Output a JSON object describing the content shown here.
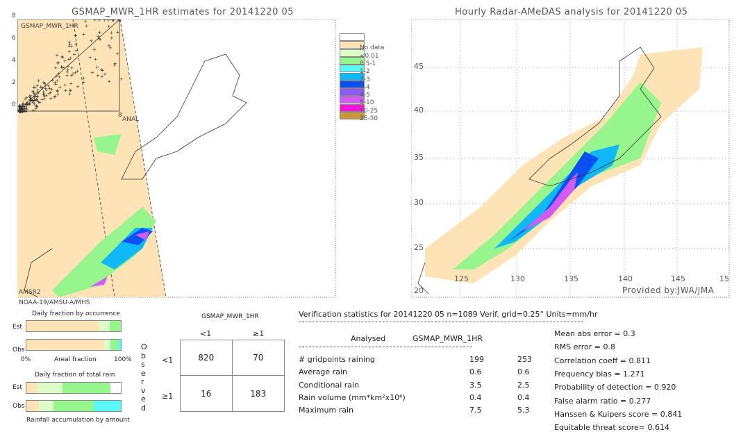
{
  "left_map": {
    "title": "GSMAP_MWR_1HR estimates for 20141220 05",
    "inset_label": "GSMAP_MWR_1HR",
    "inset_ticks": [
      "0",
      "2",
      "4",
      "6",
      "8"
    ],
    "inset_x_label": "ANAL",
    "sensor_label": "AMSR2",
    "satellite_label": "NOAA-19/AMSU-A/MHS"
  },
  "right_map": {
    "title": "Hourly Radar-AMeDAS analysis for 20141220 05",
    "lat_ticks": [
      "45",
      "40",
      "35",
      "30",
      "25",
      "20"
    ],
    "lon_ticks": [
      "125",
      "130",
      "135",
      "140",
      "145",
      "15"
    ],
    "credit": "Provided by:JWA/JMA"
  },
  "legend": [
    {
      "label": "",
      "color": "#ffffff"
    },
    {
      "label": "No data",
      "color": "#fde3b5"
    },
    {
      "label": "<0.01",
      "color": "#dcfcc8"
    },
    {
      "label": "0.5-1",
      "color": "#96f58c"
    },
    {
      "label": "1-2",
      "color": "#5cf8f8"
    },
    {
      "label": "2-3",
      "color": "#10b8f8"
    },
    {
      "label": "3-4",
      "color": "#0a50f5"
    },
    {
      "label": "4-5",
      "color": "#8c5af5"
    },
    {
      "label": "5-10",
      "color": "#d25af5"
    },
    {
      "label": "10-25",
      "color": "#f514dc"
    },
    {
      "label": "25-50",
      "color": "#c8963c"
    }
  ],
  "occurrence": {
    "title": "Daily fraction by occurrence",
    "est_label": "Est",
    "obs_label": "Obs",
    "axis_left": "0%",
    "axis_mid": "Areal fraction",
    "axis_right": "100%",
    "est": [
      {
        "pct": 77,
        "color": "#fde3b5"
      },
      {
        "pct": 11,
        "color": "#dcfcc8"
      },
      {
        "pct": 12,
        "color": "#96f58c"
      }
    ],
    "obs": [
      {
        "pct": 82,
        "color": "#fde3b5"
      },
      {
        "pct": 7,
        "color": "#dcfcc8"
      },
      {
        "pct": 8,
        "color": "#96f58c"
      },
      {
        "pct": 3,
        "color": "#5cf8f8"
      }
    ]
  },
  "total_rain": {
    "title": "Daily fraction of total rain",
    "est_label": "Est",
    "obs_label": "Obs",
    "footer": "Rainfall accumulation by amount",
    "est": [
      {
        "pct": 11,
        "color": "#fde3b5"
      },
      {
        "pct": 27,
        "color": "#dcfcc8"
      },
      {
        "pct": 51,
        "color": "#96f58c"
      }
    ],
    "obs": [
      {
        "pct": 13,
        "color": "#fde3b5"
      },
      {
        "pct": 16,
        "color": "#dcfcc8"
      },
      {
        "pct": 42,
        "color": "#96f58c"
      },
      {
        "pct": 29,
        "color": "#5cf8f8"
      }
    ]
  },
  "contingency": {
    "title": "GSMAP_MWR_1HR",
    "col_headers": [
      "<1",
      "≥1"
    ],
    "row_headers": [
      "<1",
      "≥1"
    ],
    "side_label": "Observed",
    "cells": [
      [
        "820",
        "70"
      ],
      [
        "16",
        "183"
      ]
    ]
  },
  "stats": {
    "header": "Verification statistics for 20141220 05   n=1089   Verif. grid=0.25°   Units=mm/hr",
    "col_analysed": "Analysed",
    "col_est": "GSMAP_MWR_1HR",
    "rows": [
      {
        "label": "# gridpoints raining",
        "a": "199",
        "b": "253"
      },
      {
        "label": "Average rain",
        "a": "0.6",
        "b": "0.6"
      },
      {
        "label": "Conditional rain",
        "a": "3.5",
        "b": "2.5"
      },
      {
        "label": "Rain volume (mm*km²x10⁶)",
        "a": "0.4",
        "b": "0.4"
      },
      {
        "label": "Maximum rain",
        "a": "7.5",
        "b": "5.3"
      }
    ],
    "scores": [
      "Mean abs error = 0.3",
      "RMS error = 0.8",
      "Correlation coeff = 0.811",
      "Frequency bias = 1.271",
      "Probability of detection = 0.920",
      "False alarm ratio = 0.277",
      "Hanssen & Kuipers score = 0.841",
      "Equitable threat score= 0.614"
    ]
  }
}
